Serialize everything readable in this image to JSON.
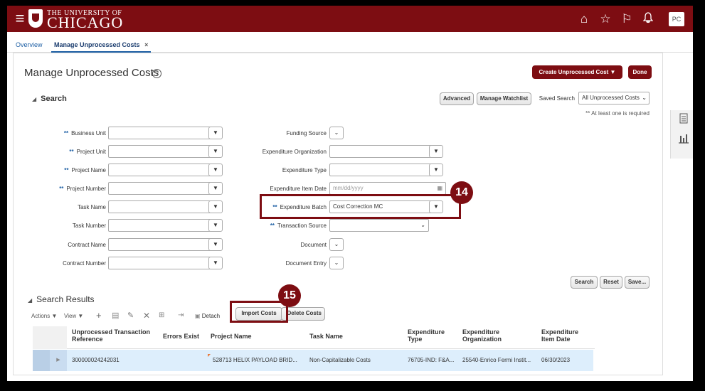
{
  "header": {
    "university_small": "THE UNIVERSITY OF",
    "university_big": "CHICAGO",
    "avatar": "PC",
    "icons": [
      "home-icon",
      "favorites-star-icon",
      "flag-icon",
      "notifications-bell-icon"
    ]
  },
  "tabs": [
    {
      "label": "Overview"
    },
    {
      "label": "Manage Unprocessed Costs"
    }
  ],
  "page": {
    "title": "Manage Unprocessed Costs",
    "help": "?",
    "create_button": "Create Unprocessed Cost ▼",
    "done_button": "Done"
  },
  "search": {
    "heading": "Search",
    "advanced": "Advanced",
    "manage_watchlist": "Manage Watchlist",
    "saved_search_label": "Saved Search",
    "saved_search_value": "All Unprocessed Costs",
    "required_note": "** At least one is required",
    "req_marker": "**",
    "fields_left": {
      "business_unit": "Business Unit",
      "project_unit": "Project Unit",
      "project_name": "Project Name",
      "project_number": "Project Number",
      "task_name": "Task Name",
      "task_number": "Task Number",
      "contract_name": "Contract Name",
      "contract_number": "Contract Number"
    },
    "fields_right": {
      "funding_source": "Funding Source",
      "expenditure_organization": "Expenditure Organization",
      "expenditure_type": "Expenditure Type",
      "expenditure_item_date": "Expenditure Item Date",
      "expenditure_item_date_placeholder": "mm/dd/yyyy",
      "expenditure_batch": "Expenditure Batch",
      "expenditure_batch_value": "Cost Correction MC",
      "transaction_source": "Transaction Source",
      "document": "Document",
      "document_entry": "Document Entry"
    },
    "search_button": "Search",
    "reset_button": "Reset",
    "save_button": "Save..."
  },
  "callouts": {
    "first": "14",
    "second": "15"
  },
  "results": {
    "heading": "Search Results",
    "actions": "Actions ▼",
    "view": "View ▼",
    "detach": "Detach",
    "import_costs": "Import Costs",
    "delete_costs": "Delete Costs",
    "columns": {
      "ref": "Unprocessed Transaction Reference",
      "errors": "Errors Exist",
      "project": "Project Name",
      "task": "Task Name",
      "exp_type": "Expenditure Type",
      "exp_org": "Expenditure Organization",
      "item_date": "Expenditure Item Date"
    },
    "rows": [
      {
        "ref": "300000024242031",
        "errors": "",
        "project": "528713 HELIX PAYLOAD BRID...",
        "task": "Non-Capitalizable Costs",
        "exp_type": "76705-IND: F&A...",
        "exp_org": "25540-Enrico Fermi Instit...",
        "item_date": "06/30/2023"
      }
    ]
  },
  "colors": {
    "brand": "#7d0d12",
    "link": "#1d5fa4",
    "row_highlight": "#ddeefc"
  }
}
